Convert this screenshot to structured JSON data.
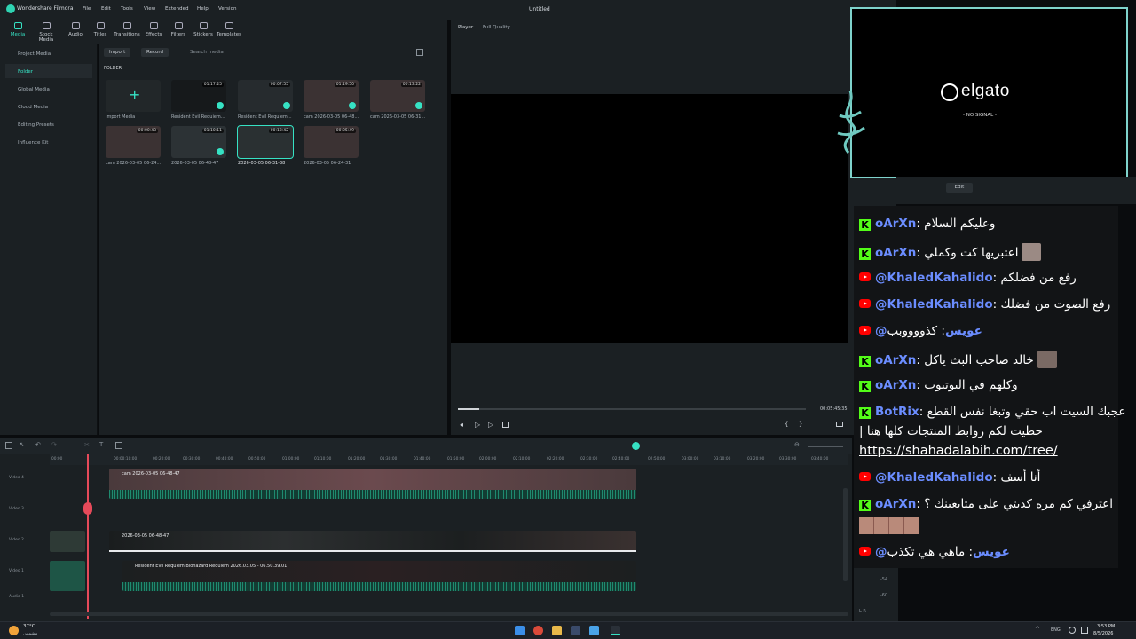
{
  "titlebar": {
    "app_name": "Wondershare Filmora",
    "menu": [
      "File",
      "Edit",
      "Tools",
      "View",
      "Extended",
      "Help",
      "Version"
    ],
    "doc_title": "Untitled"
  },
  "toolbar": {
    "items": [
      "Media",
      "Stock Media",
      "Audio",
      "Titles",
      "Transitions",
      "Effects",
      "Filters",
      "Stickers",
      "Templates"
    ],
    "active": "Media"
  },
  "sidebar": {
    "items": [
      "Project Media",
      "Folder",
      "Global Media",
      "Cloud Media",
      "Editing Presets",
      "Influence Kit"
    ]
  },
  "media": {
    "import_label": "Import",
    "record_label": "Record",
    "search_placeholder": "Search media",
    "folder_label": "FOLDER",
    "items": [
      {
        "label": "Import Media",
        "duration": ""
      },
      {
        "label": "Resident Evil Requiem...",
        "duration": "01:17:25"
      },
      {
        "label": "Resident Evil Requiem...",
        "duration": "00:07:55"
      },
      {
        "label": "cam 2026-03-05 06-48...",
        "duration": "01:19:50"
      },
      {
        "label": "cam 2026-03-05 06-31...",
        "duration": "00:13:22"
      },
      {
        "label": "cam 2026-03-05 06-24...",
        "duration": "00:00:48"
      },
      {
        "label": "2026-03-05 06-48-47",
        "duration": "01:10:11"
      },
      {
        "label": "2026-03-05 06-31-38",
        "duration": "00:13:42"
      },
      {
        "label": "2026-03-05 06-24-31",
        "duration": "00:05:49"
      }
    ]
  },
  "player": {
    "label": "Player",
    "quality": "Full Quality",
    "timecode": "00:05:45:35",
    "progress": 0.06
  },
  "timeline": {
    "ticks": [
      "00:00",
      "00:00:10:00",
      "00:20:00",
      "00:30:00",
      "00:40:00",
      "00:50:00",
      "01:00:00",
      "01:10:00",
      "01:20:00",
      "01:30:00",
      "01:40:00",
      "01:50:00",
      "02:00:00",
      "02:10:00",
      "02:20:00",
      "02:30:00",
      "02:40:00",
      "02:50:00",
      "03:00:00",
      "03:10:00",
      "03:20:00",
      "03:30:00",
      "03:40:00",
      "03:50:00"
    ],
    "tracks": [
      "Video 4",
      "Video 3",
      "Video 2",
      "Video 1",
      "Audio 1"
    ],
    "clips": [
      {
        "name": "cam 2026-03-05 06-48-47"
      },
      {
        "name": "2026-03-05 06-48-47"
      },
      {
        "name": "Resident Evil Requiem Biohazard Requiem 2026.03.05 - 06.50.39.01"
      }
    ]
  },
  "overlay": {
    "brand": "elgato",
    "status": "- NO SIGNAL -",
    "edit_label": "Edit"
  },
  "chat": [
    {
      "platform": "kick",
      "user": "oArXn",
      "message": "وعليكم السلام",
      "emote": false
    },
    {
      "platform": "kick",
      "user": "oArXn",
      "message": "اعتبريها كت وكملي",
      "emote": true
    },
    {
      "platform": "youtube",
      "user": "@KhaledKahalido",
      "message": "رفع من فضلكم",
      "emote": false
    },
    {
      "platform": "youtube",
      "user": "@KhaledKahalido",
      "message": "رفع الصوت من فضلك",
      "emote": false
    },
    {
      "platform": "youtube",
      "user": "@غويس",
      "message": "كذووووبب",
      "emote": false
    },
    {
      "platform": "kick",
      "user": "oArXn",
      "message": "خالد صاحب البث ياكل",
      "emote": true
    },
    {
      "platform": "kick",
      "user": "oArXn",
      "message": "وكلهم في اليوتيوب",
      "emote": false
    },
    {
      "platform": "kick",
      "user": "BotRix",
      "message": "عجبك السيت اب حقي وتبغا نفس القطع",
      "line2": "| حطيت لكم روابط المنتجات كلها هنا",
      "link": "https://shahadalabih.com/tree/"
    },
    {
      "platform": "youtube",
      "user": "@KhaledKahalido",
      "message": "أنا أسف",
      "emote": false
    },
    {
      "platform": "kick",
      "user": "oArXn",
      "message": "اعترفي كم مره كذبتي على متابعينك ؟",
      "emote": false
    },
    {
      "platform": "youtube",
      "user": "@غويس",
      "message": "ماهي هي تكذب",
      "emote": false
    }
  ],
  "taskbar": {
    "temp": "37°C",
    "weather": "مشمس",
    "lang": "ENG",
    "time": "3:53 PM",
    "date": "8/5/2026"
  },
  "colors": {
    "accent": "#36e2c4",
    "kick": "#53fc18",
    "youtube": "#ff0000",
    "username": "#6b8dff"
  }
}
